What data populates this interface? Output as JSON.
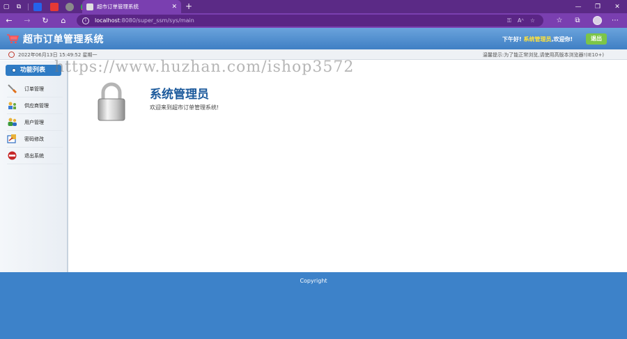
{
  "browser": {
    "tab_title": "超市订单管理系统",
    "url_host": "localhost",
    "url_path": ":8080/super_ssm/sys/main",
    "accent": "#7a3fb0"
  },
  "header": {
    "title": "超市订单管理系统",
    "greeting": "下午好!",
    "user_name": "系统管理员",
    "welcome_suffix": ",欢迎你!",
    "logout_label": "退出"
  },
  "infobar": {
    "datetime": "2022年06月13日 15:49:52 星期一",
    "tips": "温馨提示:为了能正常浏览,请使用高版本浏览器!(IE10+)"
  },
  "sidebar": {
    "title": "功能列表",
    "items": [
      {
        "label": "订单管理",
        "icon": "order-icon"
      },
      {
        "label": "供应商管理",
        "icon": "supplier-icon"
      },
      {
        "label": "用户管理",
        "icon": "users-icon"
      },
      {
        "label": "密码修改",
        "icon": "password-icon"
      },
      {
        "label": "退出系统",
        "icon": "exit-icon"
      }
    ]
  },
  "main": {
    "role": "系统管理员",
    "welcome": "欢迎来到超市订单管理系统!"
  },
  "watermark": "https://www.huzhan.com/ishop3572",
  "footer": {
    "copyright": "Copyright"
  }
}
